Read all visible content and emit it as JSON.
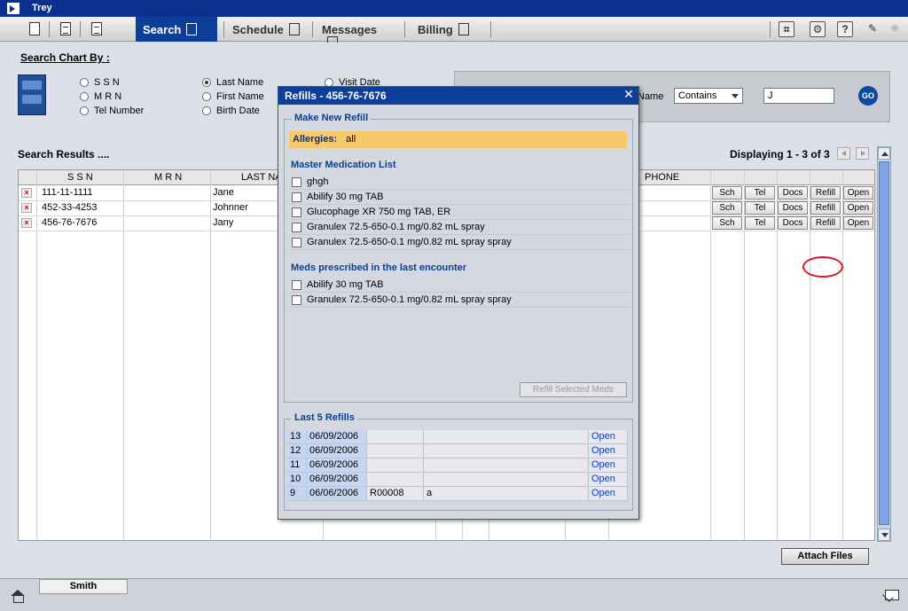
{
  "app": {
    "title": "Trey"
  },
  "tabs": [
    {
      "label": "Search"
    },
    {
      "label": "Schedule"
    },
    {
      "label": "Messages"
    },
    {
      "label": "Billing"
    }
  ],
  "search_chart": {
    "title": "Search Chart By :",
    "options": [
      {
        "label": "S S N",
        "checked": false
      },
      {
        "label": "M R N",
        "checked": false
      },
      {
        "label": "Tel Number",
        "checked": false
      },
      {
        "label": "Last Name",
        "checked": true
      },
      {
        "label": "First Name",
        "checked": false
      },
      {
        "label": "Birth Date",
        "checked": false
      },
      {
        "label": "Visit Date",
        "checked": false
      }
    ],
    "field_label": "Name",
    "match_select": "Contains",
    "query": "J",
    "go_label": "GO"
  },
  "results": {
    "title": "Search Results ....",
    "displaying": "Displaying 1 - 3 of 3",
    "columns": [
      "S S N",
      "M R N",
      "LAST NA",
      "PHONE"
    ],
    "rows": [
      {
        "ssn": "111-11-1111",
        "mrn": "",
        "last": "Jane"
      },
      {
        "ssn": "452-33-4253",
        "mrn": "",
        "last": "Johnner"
      },
      {
        "ssn": "456-76-7676",
        "mrn": "",
        "last": "Jany"
      }
    ],
    "row_actions": [
      "Sch",
      "Tel",
      "Docs",
      "Refill",
      "Open"
    ]
  },
  "attach_label": "Attach Files",
  "bottom": {
    "open_tab": "Smith"
  },
  "modal": {
    "title": "Refills - 456-76-7676",
    "new_refill_legend": "Make New Refill",
    "allergies_label": "Allergies:",
    "allergies_value": "all",
    "master_title": "Master Medication List",
    "master_meds": [
      "ghgh",
      "Abilify 30 mg TAB",
      "Glucophage XR 750 mg TAB, ER",
      "Granulex 72.5-650-0.1 mg/0.82 mL spray",
      "Granulex 72.5-650-0.1 mg/0.82 mL spray spray"
    ],
    "last_encounter_title": "Meds prescribed in the last encounter",
    "last_encounter_meds": [
      "Abilify 30 mg TAB",
      "Granulex 72.5-650-0.1 mg/0.82 mL spray spray"
    ],
    "refill_selected_label": "Refill Selected Meds",
    "last5_legend": "Last 5 Refills",
    "last5": [
      {
        "num": "13",
        "date": "06/09/2006",
        "ref": "",
        "note": "",
        "action": "Open"
      },
      {
        "num": "12",
        "date": "06/09/2006",
        "ref": "",
        "note": "",
        "action": "Open"
      },
      {
        "num": "11",
        "date": "06/09/2006",
        "ref": "",
        "note": "",
        "action": "Open"
      },
      {
        "num": "10",
        "date": "06/09/2006",
        "ref": "",
        "note": "",
        "action": "Open"
      },
      {
        "num": "9",
        "date": "06/06/2006",
        "ref": "R00008",
        "note": "a",
        "action": "Open"
      }
    ]
  }
}
